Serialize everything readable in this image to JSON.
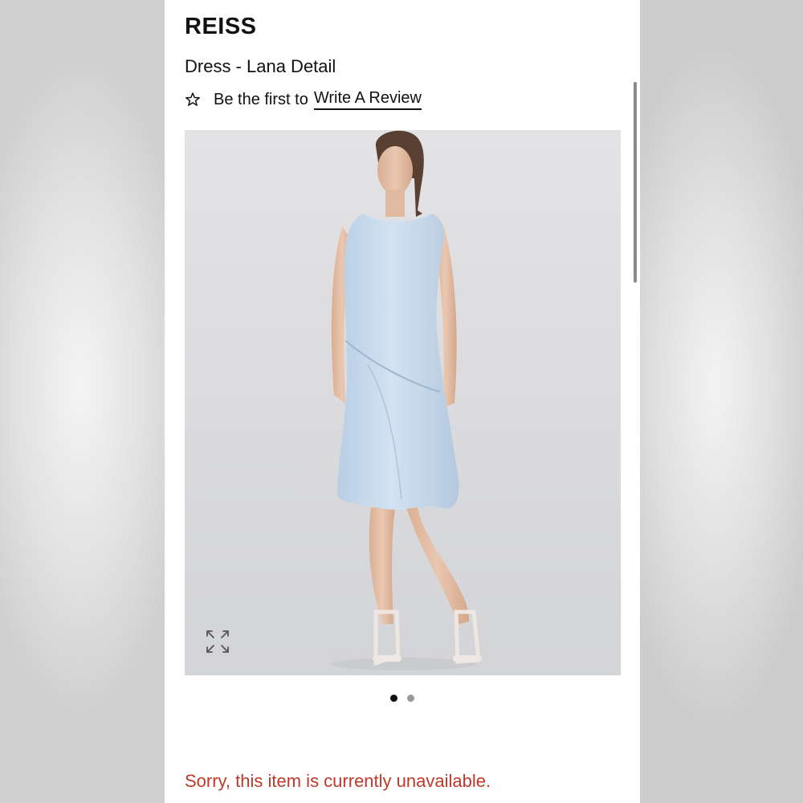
{
  "brand": "REISS",
  "product": {
    "title": "Dress - Lana Detail"
  },
  "review": {
    "prefix": "Be the first to",
    "link_label": "Write A Review",
    "icon": "star-outline-icon"
  },
  "gallery": {
    "image_description": "",
    "expand_icon": "expand-icon",
    "dots": [
      {
        "state": "active"
      },
      {
        "state": "inactive"
      }
    ]
  },
  "status": {
    "message": "Sorry, this item is currently unavailable."
  },
  "colors": {
    "status_text": "#c0392b",
    "dress": "#c9dcef"
  }
}
